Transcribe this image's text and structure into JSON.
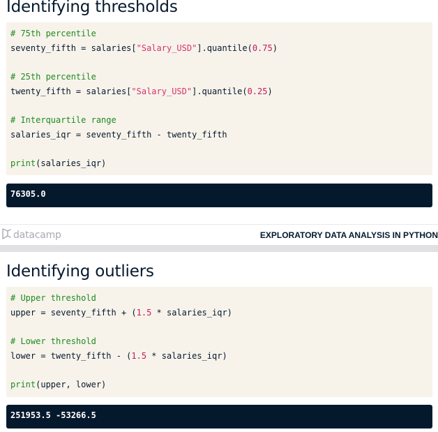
{
  "slide1": {
    "title": "Identifying thresholds",
    "code_lines": [
      {
        "cmt": "# 75th percentile"
      },
      {
        "pre": "seventy_fifth = salaries[",
        "str": "\"Salary_USD\"",
        "mid": "].quantile(",
        "num": "0.75",
        "post": ")"
      },
      {},
      {
        "cmt": "# 25th percentile"
      },
      {
        "pre": "twenty_fifth = salaries[",
        "str": "\"Salary_USD\"",
        "mid": "].quantile(",
        "num": "0.25",
        "post": ")"
      },
      {},
      {
        "cmt": "# Interquartile range"
      },
      {
        "pre": "salaries_iqr = seventy_fifth - twenty_fifth"
      },
      {},
      {
        "fn": "print",
        "post": "(salaries_iqr)"
      }
    ],
    "output": "76305.0"
  },
  "footer": {
    "logo_text": "datacamp",
    "course_title": "EXPLORATORY DATA ANALYSIS IN PYTHON"
  },
  "slide2": {
    "title": "Identifying outliers",
    "code_lines": [
      {
        "cmt": "# Upper threshold"
      },
      {
        "pre": "upper = seventy_fifth + (",
        "num": "1.5",
        "post": " * salaries_iqr)"
      },
      {},
      {
        "cmt": "# Lower threshold"
      },
      {
        "pre": "lower = twenty_fifth - (",
        "num": "1.5",
        "post": " * salaries_iqr)"
      },
      {},
      {
        "fn": "print",
        "post": "(upper, lower)"
      }
    ],
    "output": "251953.5 -53266.5"
  },
  "colors": {
    "code_bg": "#f7f3eb",
    "output_bg": "#05192d",
    "comment": "#1f8a1f",
    "string": "#d6336c",
    "number": "#c2185b"
  }
}
